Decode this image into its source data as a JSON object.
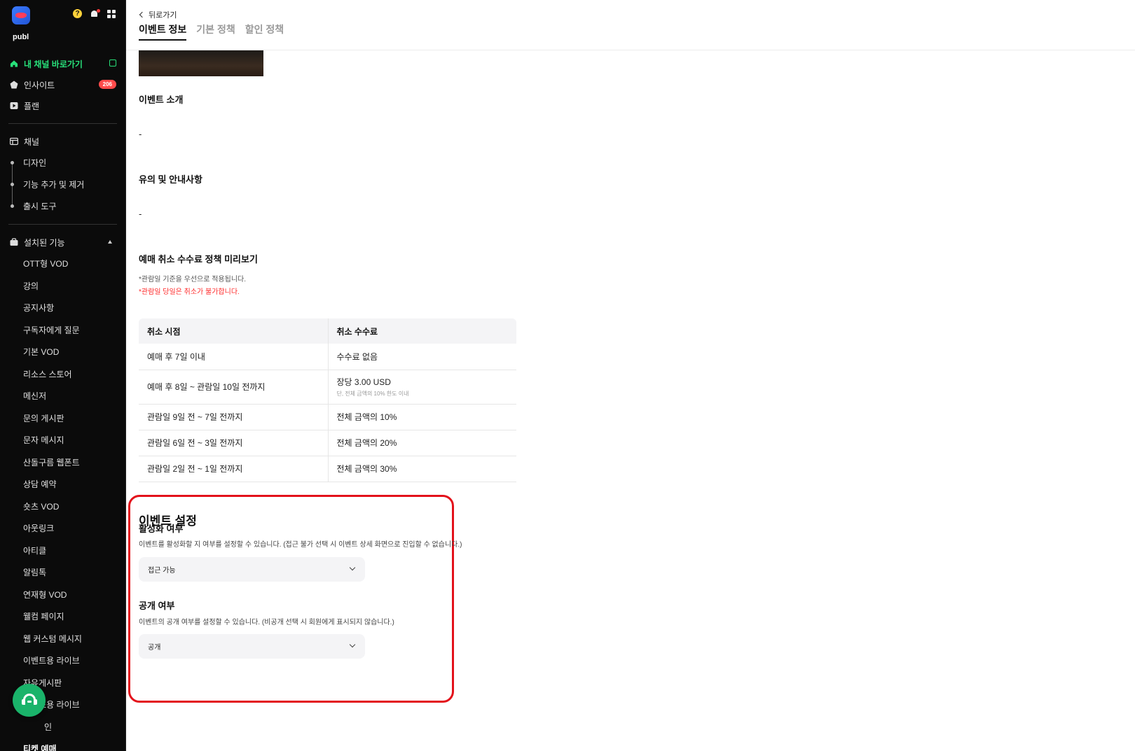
{
  "brand": {
    "name": "publ"
  },
  "sidebar": {
    "primary": [
      {
        "label": "내 채널 바로가기",
        "icon": "home-icon",
        "active": true
      },
      {
        "label": "인사이트",
        "icon": "insight-icon",
        "badge": "206"
      },
      {
        "label": "플랜",
        "icon": "plan-icon"
      }
    ],
    "channel": {
      "label": "채널",
      "icon": "channel-icon",
      "children": [
        "디자인",
        "기능 추가 및 제거",
        "출시 도구"
      ]
    },
    "installed": {
      "label": "설치된 기능",
      "icon": "installed-features-icon",
      "items": [
        "OTT형 VOD",
        "강의",
        "공지사항",
        "구독자에게 질문",
        "기본 VOD",
        "리소스 스토어",
        "메신저",
        "문의 게시판",
        "문자 메시지",
        "산돌구름 웹폰트",
        "상담 예약",
        "숏츠 VOD",
        "아웃링크",
        "아티클",
        "알림톡",
        "연재형 VOD",
        "웰컴 페이지",
        "웹 커스텀 메시지",
        "이벤트용 라이브",
        "자유게시판",
        "커머스용 라이브",
        "쿠폰 및 할인",
        "티켓 예매"
      ],
      "partial_last_visible": "인",
      "current": "티켓 예매"
    }
  },
  "header": {
    "back_label": "뒤로가기",
    "tabs": [
      {
        "label": "이벤트 정보",
        "active": true
      },
      {
        "label": "기본 정책",
        "active": false
      },
      {
        "label": "할인 정책",
        "active": false
      }
    ]
  },
  "content": {
    "intro_title": "이벤트 소개",
    "intro_value": "-",
    "notice_title": "유의 및 안내사항",
    "notice_value": "-",
    "cancel_title": "예매 취소 수수료 정책 미리보기",
    "cancel_note1": "*관람일 기준을 우선으로 적용됩니다.",
    "cancel_note2": "*관람일 당일은 취소가 불가합니다.",
    "cancel_table": {
      "headers": [
        "취소 시점",
        "취소 수수료"
      ],
      "rows": [
        {
          "when": "예매 후 7일 이내",
          "fee": "수수료 없음",
          "sub": ""
        },
        {
          "when": "예매 후 8일 ~ 관람일 10일 전까지",
          "fee": "장당 3.00 USD",
          "sub": "단, 전체 금액의 10% 한도 이내"
        },
        {
          "when": "관람일 9일 전 ~ 7일 전까지",
          "fee": "전체 금액의 10%",
          "sub": ""
        },
        {
          "when": "관람일 6일 전 ~ 3일 전까지",
          "fee": "전체 금액의 20%",
          "sub": ""
        },
        {
          "when": "관람일 2일 전 ~ 1일 전까지",
          "fee": "전체 금액의 30%",
          "sub": ""
        }
      ]
    }
  },
  "settings": {
    "title": "이벤트 설정",
    "activation": {
      "label": "활성화 여부",
      "desc": "이벤트를 활성화할 지 여부를 설정할 수 있습니다. (접근 불가 선택 시 이벤트 상세 화면으로 진입할 수 없습니다.)",
      "value": "접근 가능"
    },
    "visibility": {
      "label": "공개 여부",
      "desc": "이벤트의 공개 여부를 설정할 수 있습니다. (비공개 선택 시 회원에게 표시되지 않습니다.)",
      "value": "공개"
    },
    "highlight_color": "#e3121b"
  },
  "colors": {
    "accent_green": "#28e07a",
    "badge_red": "#ff4b4b",
    "warning_red": "#ff2a2a"
  }
}
